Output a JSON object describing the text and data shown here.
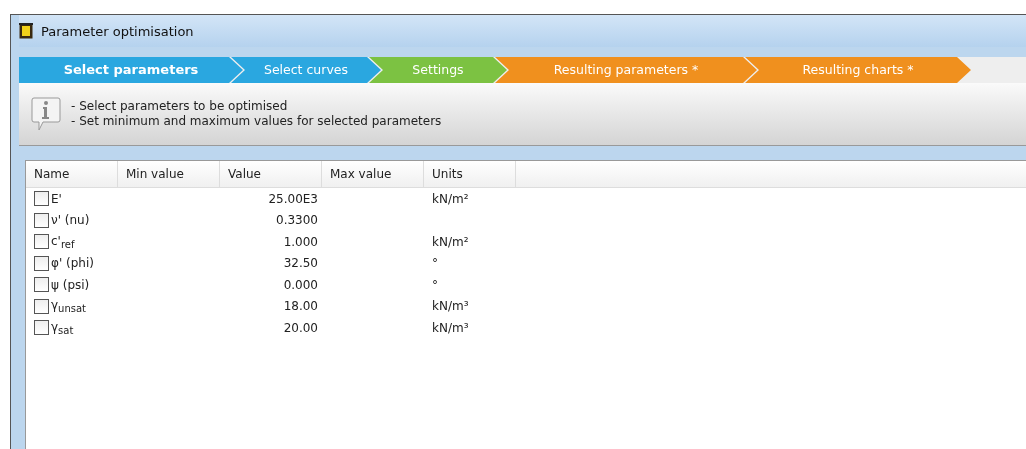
{
  "window": {
    "title": "Parameter optimisation"
  },
  "steps": [
    {
      "label": "Select parameters",
      "selected": true,
      "color": "#2aa7e0"
    },
    {
      "label": "Select curves",
      "selected": false,
      "color": "#2aa7e0"
    },
    {
      "label": "Settings",
      "selected": false,
      "color": "#7cc242"
    },
    {
      "label": "Resulting parameters *",
      "selected": false,
      "color": "#f0901e"
    },
    {
      "label": "Resulting charts *",
      "selected": false,
      "color": "#f0901e"
    }
  ],
  "info": [
    "- Select parameters to be optimised",
    "- Set minimum and maximum values for selected parameters"
  ],
  "table": {
    "columns": [
      "Name",
      "Min value",
      "Value",
      "Max value",
      "Units"
    ],
    "rows": [
      {
        "name": "E'",
        "checked": false,
        "value": "25.00E3",
        "units": "kN/m²"
      },
      {
        "name": "ν' (nu)",
        "checked": false,
        "value": "0.3300"
      },
      {
        "name": "c'$_{ref}$",
        "checked": false,
        "value": "1.000",
        "units": "kN/m²"
      },
      {
        "name": "φ' (phi)",
        "checked": false,
        "value": "32.50",
        "units": "°"
      },
      {
        "name": "ψ (psi)",
        "checked": false,
        "value": "0.000",
        "units": "°"
      },
      {
        "name": "γ$_{unsat}$",
        "checked": false,
        "value": "18.00",
        "units": "kN/m³"
      },
      {
        "name": "γ$_{sat}$",
        "checked": false,
        "value": "20.00",
        "units": "kN/m³"
      }
    ]
  }
}
